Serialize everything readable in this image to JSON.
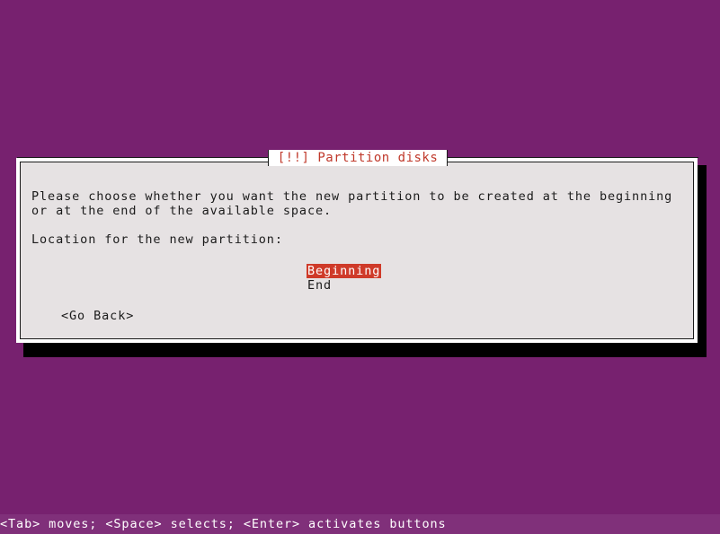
{
  "screen": {
    "background_color": "#77216f"
  },
  "dialog": {
    "title": "[!!] Partition disks",
    "title_color": "#c0392b",
    "background_color": "#e6e2e3",
    "frame_color": "#ffffff",
    "border_color": "#1b1b1b",
    "shadow_color": "#000000",
    "body_text": "Please choose whether you want the new partition to be created at the beginning or at the end of the available space.",
    "prompt_label": "Location for the new partition:",
    "options": [
      {
        "label": "Beginning",
        "selected": true
      },
      {
        "label": "End",
        "selected": false
      }
    ],
    "selection_color": "#cf3a29",
    "selection_text_color": "#ffffff",
    "buttons": [
      {
        "label": "<Go Back>",
        "selected": false
      }
    ]
  },
  "status_bar": {
    "text": "<Tab> moves; <Space> selects; <Enter> activates buttons",
    "background_color": "#80307a",
    "text_color": "#ffffff"
  }
}
